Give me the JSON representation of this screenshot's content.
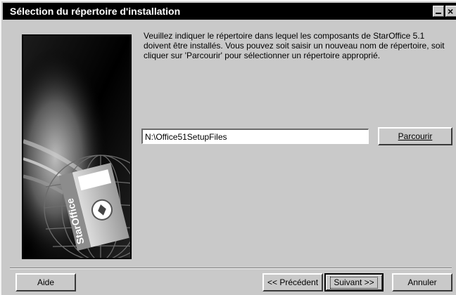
{
  "window": {
    "title": "Sélection du répertoire d'installation"
  },
  "main": {
    "instructions": "Veuillez indiquer le répertoire dans lequel les composants de StarOffice 5.1 doivent être installés. Vous pouvez soit saisir un nouveau nom de répertoire, soit cliquer sur 'Parcourir' pour sélectionner un répertoire approprié.",
    "path_value": "N:\\Office51SetupFiles",
    "browse_label": "Parcourir"
  },
  "illustration": {
    "box_text": "StarOffice"
  },
  "footer": {
    "help_label": "Aide",
    "prev_label": "<< Précédent",
    "next_label": "Suivant >>",
    "cancel_label": "Annuler"
  }
}
